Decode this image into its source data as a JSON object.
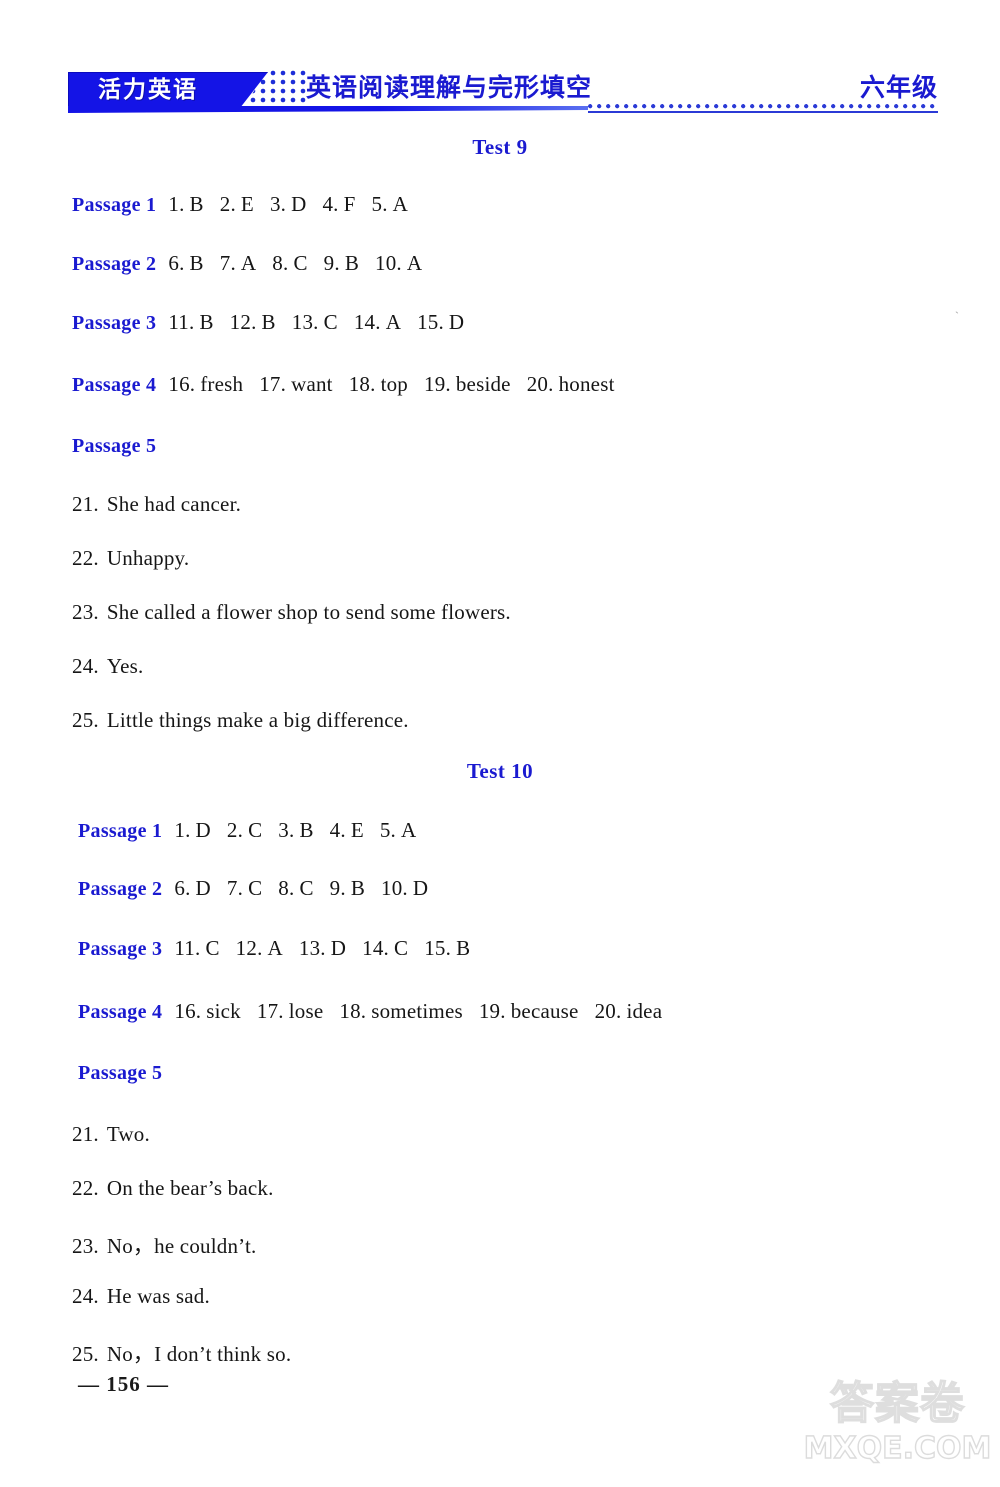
{
  "header": {
    "brand": "活力英语",
    "title": "英语阅读理解与完形填空",
    "grade": "六年级",
    "accent_color": "#1414e6",
    "title_color": "#1a1ad0"
  },
  "tests": [
    {
      "heading": "Test 9",
      "passages": [
        {
          "label": "Passage 1",
          "items": [
            {
              "num": "1.",
              "ans": "B"
            },
            {
              "num": "2.",
              "ans": "E"
            },
            {
              "num": "3.",
              "ans": "D"
            },
            {
              "num": "4.",
              "ans": "F"
            },
            {
              "num": "5.",
              "ans": "A"
            }
          ]
        },
        {
          "label": "Passage 2",
          "items": [
            {
              "num": "6.",
              "ans": "B"
            },
            {
              "num": "7.",
              "ans": "A"
            },
            {
              "num": "8.",
              "ans": "C"
            },
            {
              "num": "9.",
              "ans": "B"
            },
            {
              "num": "10.",
              "ans": "A"
            }
          ]
        },
        {
          "label": "Passage 3",
          "items": [
            {
              "num": "11.",
              "ans": "B"
            },
            {
              "num": "12.",
              "ans": "B"
            },
            {
              "num": "13.",
              "ans": "C"
            },
            {
              "num": "14.",
              "ans": "A"
            },
            {
              "num": "15.",
              "ans": "D"
            }
          ]
        },
        {
          "label": "Passage 4",
          "items": [
            {
              "num": "16.",
              "ans": "fresh"
            },
            {
              "num": "17.",
              "ans": "want"
            },
            {
              "num": "18.",
              "ans": "top"
            },
            {
              "num": "19.",
              "ans": "beside"
            },
            {
              "num": "20.",
              "ans": "honest"
            }
          ]
        }
      ],
      "passage5": {
        "label": "Passage 5",
        "answers": [
          {
            "num": "21.",
            "text": "She had cancer."
          },
          {
            "num": "22.",
            "text": "Unhappy."
          },
          {
            "num": "23.",
            "text": "She called a flower shop to send some flowers."
          },
          {
            "num": "24.",
            "text": "Yes."
          },
          {
            "num": "25.",
            "text": "Little things make a big difference."
          }
        ]
      }
    },
    {
      "heading": "Test 10",
      "passages": [
        {
          "label": "Passage 1",
          "items": [
            {
              "num": "1.",
              "ans": "D"
            },
            {
              "num": "2.",
              "ans": "C"
            },
            {
              "num": "3.",
              "ans": "B"
            },
            {
              "num": "4.",
              "ans": "E"
            },
            {
              "num": "5.",
              "ans": "A"
            }
          ]
        },
        {
          "label": "Passage 2",
          "items": [
            {
              "num": "6.",
              "ans": "D"
            },
            {
              "num": "7.",
              "ans": "C"
            },
            {
              "num": "8.",
              "ans": "C"
            },
            {
              "num": "9.",
              "ans": "B"
            },
            {
              "num": "10.",
              "ans": "D"
            }
          ]
        },
        {
          "label": "Passage 3",
          "items": [
            {
              "num": "11.",
              "ans": "C"
            },
            {
              "num": "12.",
              "ans": "A"
            },
            {
              "num": "13.",
              "ans": "D"
            },
            {
              "num": "14.",
              "ans": "C"
            },
            {
              "num": "15.",
              "ans": "B"
            }
          ]
        },
        {
          "label": "Passage 4",
          "items": [
            {
              "num": "16.",
              "ans": "sick"
            },
            {
              "num": "17.",
              "ans": "lose"
            },
            {
              "num": "18.",
              "ans": "sometimes"
            },
            {
              "num": "19.",
              "ans": "because"
            },
            {
              "num": "20.",
              "ans": "idea"
            }
          ]
        }
      ],
      "passage5": {
        "label": "Passage 5",
        "answers": [
          {
            "num": "21.",
            "text": "Two."
          },
          {
            "num": "22.",
            "text": "On the bear’s back."
          },
          {
            "num": "23.",
            "text": "No，he couldn’t."
          },
          {
            "num": "24.",
            "text": "He was sad."
          },
          {
            "num": "25.",
            "text": "No，I don’t think so."
          }
        ]
      }
    }
  ],
  "footer": {
    "page_number": "— 156 —"
  },
  "watermark": {
    "chinese": "答案卷",
    "english": "MXQE.COM"
  }
}
